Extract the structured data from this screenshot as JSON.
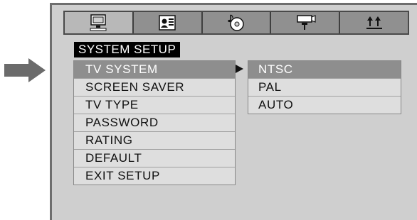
{
  "tabs": [
    {
      "icon": "monitor-icon",
      "active": true
    },
    {
      "icon": "id-card-icon",
      "active": false
    },
    {
      "icon": "audio-disc-icon",
      "active": false
    },
    {
      "icon": "video-camera-icon",
      "active": false
    },
    {
      "icon": "preferences-arrows-icon",
      "active": false
    }
  ],
  "section_title": "SYSTEM SETUP",
  "menu": {
    "items": [
      {
        "label": "TV SYSTEM"
      },
      {
        "label": "SCREEN SAVER"
      },
      {
        "label": "TV TYPE"
      },
      {
        "label": "PASSWORD"
      },
      {
        "label": "RATING"
      },
      {
        "label": "DEFAULT"
      },
      {
        "label": "EXIT SETUP"
      }
    ],
    "selected": "TV SYSTEM"
  },
  "submenu": {
    "items": [
      {
        "label": "NTSC"
      },
      {
        "label": "PAL"
      },
      {
        "label": "AUTO"
      }
    ],
    "selected": "NTSC"
  },
  "colors": {
    "screen_bg": "#cfcfcf",
    "highlight": "#8e8e8e",
    "item_bg": "#dedede",
    "title_bg": "#000000",
    "pointer_arrow": "#6b6b6b"
  }
}
